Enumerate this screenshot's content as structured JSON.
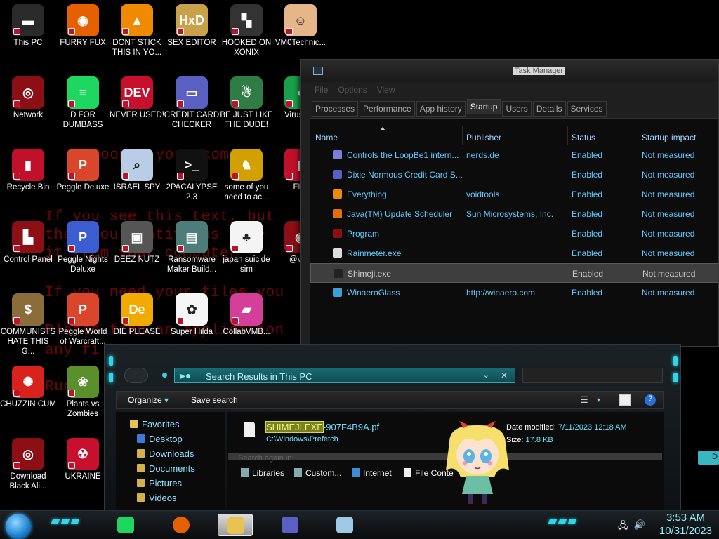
{
  "wallpaper": {
    "lines": [
      "Ooops, your compu",
      "If you see this text, but",
      "then your antivirus move",
      "it from your computer",
      "If you need your files you",
      "Please find an application",
      "any fi",
      "Run"
    ]
  },
  "desktop": {
    "icons": [
      {
        "label": "This PC",
        "icon": "this-pc-icon",
        "color": "#2a2a2a",
        "glyph": "▬"
      },
      {
        "label": "FURRY FUX",
        "icon": "firefox-icon",
        "color": "#e66000",
        "glyph": "◉"
      },
      {
        "label": "DONT STICK THIS IN YO...",
        "icon": "vlc-cone-icon",
        "color": "#f08a00",
        "glyph": "▲"
      },
      {
        "label": "SEX EDITOR",
        "icon": "hxd-editor-icon",
        "color": "#c9a14a",
        "glyph": "HxD"
      },
      {
        "label": "HOOKED ON XONIX",
        "icon": "xonix-game-icon",
        "color": "#333333",
        "glyph": "▚"
      },
      {
        "label": "VM0Technic...",
        "icon": "doctor-icon",
        "color": "#e7b58a",
        "glyph": "☺"
      },
      {
        "label": "Network",
        "icon": "alien-network-icon",
        "color": "#8b0f14",
        "glyph": "◎"
      },
      {
        "label": "D FOR DUMBASS",
        "icon": "spotify-icon",
        "color": "#1ed760",
        "glyph": "≡"
      },
      {
        "label": "NEVER USED!",
        "icon": "devcpp-icon",
        "color": "#c8102e",
        "glyph": "DEV"
      },
      {
        "label": "CREDIT CARD CHECKER",
        "icon": "credit-card-icon",
        "color": "#5a5fc4",
        "glyph": "▭"
      },
      {
        "label": "BE JUST LIKE THE DUDE!",
        "icon": "elf-icon",
        "color": "#2f7d45",
        "glyph": "☃"
      },
      {
        "label": "VirusW...",
        "icon": "virus-icon",
        "color": "#19a04a",
        "glyph": "●"
      },
      {
        "label": "Recycle Bin",
        "icon": "recycle-bin-icon",
        "color": "#c0102a",
        "glyph": "▮"
      },
      {
        "label": "Peggle Deluxe",
        "icon": "peggle-icon",
        "color": "#d9462b",
        "glyph": "P"
      },
      {
        "label": "ISRAEL SPY",
        "icon": "spy-network-icon",
        "color": "#b9cde6",
        "glyph": "⌕"
      },
      {
        "label": "2PACALYPSE 2.3",
        "icon": "terminal-icon",
        "color": "#111111",
        "glyph": ">_"
      },
      {
        "label": "some of you need to ac...",
        "icon": "dog-icon",
        "color": "#d2a000",
        "glyph": "♞"
      },
      {
        "label": "FLA",
        "icon": "flag-icon",
        "color": "#c0102a",
        "glyph": "▮"
      },
      {
        "label": "Control Panel",
        "icon": "control-panel-icon",
        "color": "#8b0f14",
        "glyph": "▙"
      },
      {
        "label": "Peggle Nights Deluxe",
        "icon": "peggle-nights-icon",
        "color": "#3b5dd1",
        "glyph": "P"
      },
      {
        "label": "DEEZ NUTZ",
        "icon": "stacked-windows-icon",
        "color": "#555555",
        "glyph": "▣"
      },
      {
        "label": "Ransomware Maker Build...",
        "icon": "ransomware-builder-icon",
        "color": "#4e7c7a",
        "glyph": "▤"
      },
      {
        "label": "japan suicide sim",
        "icon": "japan-sim-icon",
        "color": "#f4f4f4",
        "glyph": "♣"
      },
      {
        "label": "@War",
        "icon": "war-icon",
        "color": "#8b0f14",
        "glyph": "◉"
      },
      {
        "label": "COMMUNISTS HATE THIS G...",
        "icon": "money-bag-icon",
        "color": "#8a6d3b",
        "glyph": "$"
      },
      {
        "label": "Peggle World of Warcraft...",
        "icon": "peggle-wow-icon",
        "color": "#d9462b",
        "glyph": "P"
      },
      {
        "label": "DIE PLEASE",
        "icon": "die-icon",
        "color": "#f2a900",
        "glyph": "De"
      },
      {
        "label": "Super Hilda",
        "icon": "hilda-icon",
        "color": "#f6f6f6",
        "glyph": "✿"
      },
      {
        "label": "CollabVMB...",
        "icon": "collabvm-icon",
        "color": "#d43f9a",
        "glyph": "▰"
      },
      {
        "label": "CHUZZIN CUM",
        "icon": "chuzzle-icon",
        "color": "#d8231d",
        "glyph": "✺"
      },
      {
        "label": "Plants vs Zombies",
        "icon": "pvz-icon",
        "color": "#5a8f2b",
        "glyph": "❀"
      },
      {
        "label": "Download Black Ali...",
        "icon": "alien-download-icon",
        "color": "#8b0f14",
        "glyph": "◎"
      },
      {
        "label": "UKRAINE",
        "icon": "radiation-icon",
        "color": "#c8102e",
        "glyph": "☢"
      }
    ]
  },
  "task_manager": {
    "title": "Task Manager",
    "menu": [
      "File",
      "Options",
      "View"
    ],
    "tabs": [
      "Processes",
      "Performance",
      "App history",
      "Startup",
      "Users",
      "Details",
      "Services"
    ],
    "active_tab": "Startup",
    "columns": [
      "Name",
      "Publisher",
      "Status",
      "Startup impact"
    ],
    "rows": [
      {
        "name": "Controls the LoopBe1 intern...",
        "publisher": "nerds.de",
        "status": "Enabled",
        "impact": "Not measured",
        "icon": "loopbe-icon",
        "color": "#7b7fd6"
      },
      {
        "name": "Dixie Normous Credit Card S...",
        "publisher": "",
        "status": "Enabled",
        "impact": "Not measured",
        "icon": "credit-card-icon",
        "color": "#5a5fc4"
      },
      {
        "name": "Everything",
        "publisher": "voidtools",
        "status": "Enabled",
        "impact": "Not measured",
        "icon": "search-icon",
        "color": "#f08a00"
      },
      {
        "name": "Java(TM) Update Scheduler",
        "publisher": "Sun Microsystems, Inc.",
        "status": "Enabled",
        "impact": "Not measured",
        "icon": "java-icon",
        "color": "#e76f00"
      },
      {
        "name": "Program",
        "publisher": "",
        "status": "Enabled",
        "impact": "Not measured",
        "icon": "program-icon",
        "color": "#8b0f14"
      },
      {
        "name": "Rainmeter.exe",
        "publisher": "",
        "status": "Enabled",
        "impact": "Not measured",
        "icon": "raindrop-icon",
        "color": "#dddddd"
      },
      {
        "name": "Shimeji.exe",
        "publisher": "",
        "status": "Enabled",
        "impact": "Not measured",
        "icon": "shimeji-icon",
        "color": "#222222",
        "selected": true
      },
      {
        "name": "WinaeroGlass",
        "publisher": "http://winaero.com",
        "status": "Enabled",
        "impact": "Not measured",
        "icon": "glass-icon",
        "color": "#3aa0d8"
      }
    ]
  },
  "explorer": {
    "address": "Search Results in This PC",
    "command_bar": {
      "organize": "Organize",
      "save_search": "Save search"
    },
    "nav": {
      "favorites": "Favorites",
      "items": [
        "Desktop",
        "Downloads",
        "Documents",
        "Pictures",
        "Videos"
      ]
    },
    "result": {
      "name_highlight": "SHIMEJI.EXE",
      "name_rest": "-907F4B9A.pf",
      "path": "C:\\Windows\\Prefetch",
      "date_label": "Date modified:",
      "date_value": "7/11/2023 12:18 AM",
      "size_label": "Size:",
      "size_value": "17.8 KB"
    },
    "search_again": "Search again in:",
    "locations": [
      "Libraries",
      "Custom...",
      "Internet",
      "File Conte"
    ]
  },
  "partial_button": "D",
  "taskbar": {
    "apps": [
      {
        "name": "spotify",
        "icon": "spotify-icon",
        "color": "#1ed760"
      },
      {
        "name": "firefox",
        "icon": "firefox-icon",
        "color": "#e66000"
      },
      {
        "name": "file-explorer",
        "icon": "folder-icon",
        "color": "#e8c351",
        "active": true
      },
      {
        "name": "credit-card",
        "icon": "credit-card-icon",
        "color": "#5a5fc4"
      },
      {
        "name": "task-manager",
        "icon": "task-manager-icon",
        "color": "#9fc9e6"
      }
    ],
    "time": "3:53 AM",
    "date": "10/31/2023"
  }
}
